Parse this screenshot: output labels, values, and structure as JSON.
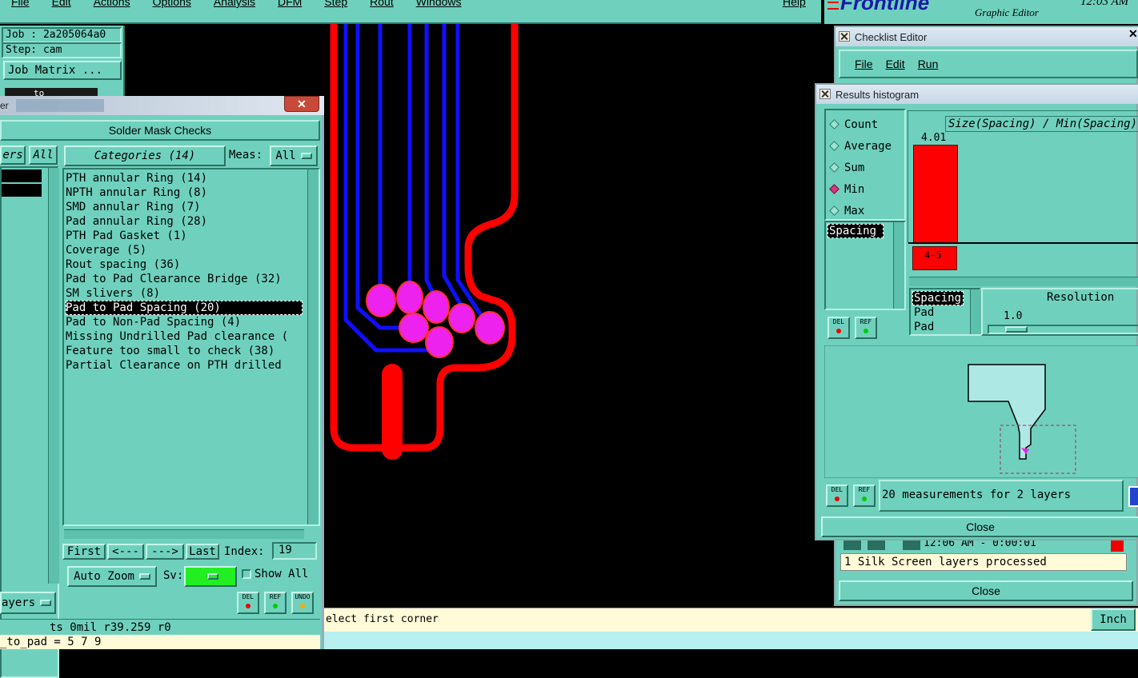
{
  "menubar": {
    "items": [
      "File",
      "Edit",
      "Actions",
      "Options",
      "Analysis",
      "DFM",
      "Step",
      "Rout",
      "Windows"
    ],
    "help": "Help"
  },
  "brand": {
    "logo": "Frontline",
    "subtitle": "Graphic Editor",
    "clock": "12:03 AM"
  },
  "job": {
    "job_label": "Job : 2a205064a0",
    "step_label": "Step: cam",
    "matrix_button": "Job Matrix ...",
    "partial_tab": "to"
  },
  "solder": {
    "title": "Solder Mask Checks",
    "layers_header": "ers",
    "all_button": "All",
    "categories_button": "Categories (14)",
    "meas_label": "Meas:",
    "meas_value": "All",
    "categories": [
      "PTH annular Ring (14)",
      "NPTH annular Ring (8)",
      "SMD annular Ring (7)",
      "Pad annular Ring (28)",
      "PTH Pad Gasket (1)",
      "Coverage (5)",
      "Rout spacing (36)",
      "Pad to Pad Clearance Bridge (32)",
      "SM slivers (8)",
      "Pad to Pad Spacing (20)",
      "Pad to Non-Pad Spacing (4)",
      "Missing Undrilled Pad clearance (",
      "Feature too small to check (38)",
      "Partial Clearance on PTH drilled"
    ],
    "selected_index": 9,
    "nav": {
      "first": "First",
      "prev": "<---",
      "next": "--->",
      "last": "Last",
      "index_label": "Index:",
      "index_value": "19"
    },
    "auto_zoom": "Auto Zoom",
    "sv_label": "Sv:",
    "show_all": "Show All",
    "layers_dropdown": "ayers",
    "del": "DEL",
    "ref": "REF",
    "undo": "UNDO"
  },
  "status": {
    "coords": "ts 0mil   r39.259  r0",
    "formula": "_to_pad = 5 7 9",
    "prompt": "elect first corner",
    "units": "Inch"
  },
  "checklist": {
    "title": "Checklist Editor",
    "menu": [
      "File",
      "Edit",
      "Run"
    ],
    "time": "12:06 AM - 0:00:01",
    "message": "1 Silk Screen layers processed",
    "close": "Close"
  },
  "histogram": {
    "title": "Results histogram",
    "modes": [
      "Count",
      "Average",
      "Sum",
      "Min",
      "Max"
    ],
    "selected_mode": "Min",
    "field_list": [
      "Spacing"
    ],
    "formula": "Size(Spacing) / Min(Spacing)",
    "bar_value": "4.01",
    "bar_label": "4-5",
    "columns": [
      "Spacing",
      "Pad",
      "Pad"
    ],
    "resolution_label": "Resolution",
    "resolution_value": "1.0",
    "status_text": "20 measurements for 2 layers",
    "close": "Close",
    "del": "DEL",
    "ref": "REF"
  },
  "colors": {
    "panel": "#6fd1bd",
    "trace_red": "#ff0000",
    "trace_blue": "#1010ff",
    "pad_magenta": "#ee22ee",
    "bar_red": "#ff0000"
  }
}
